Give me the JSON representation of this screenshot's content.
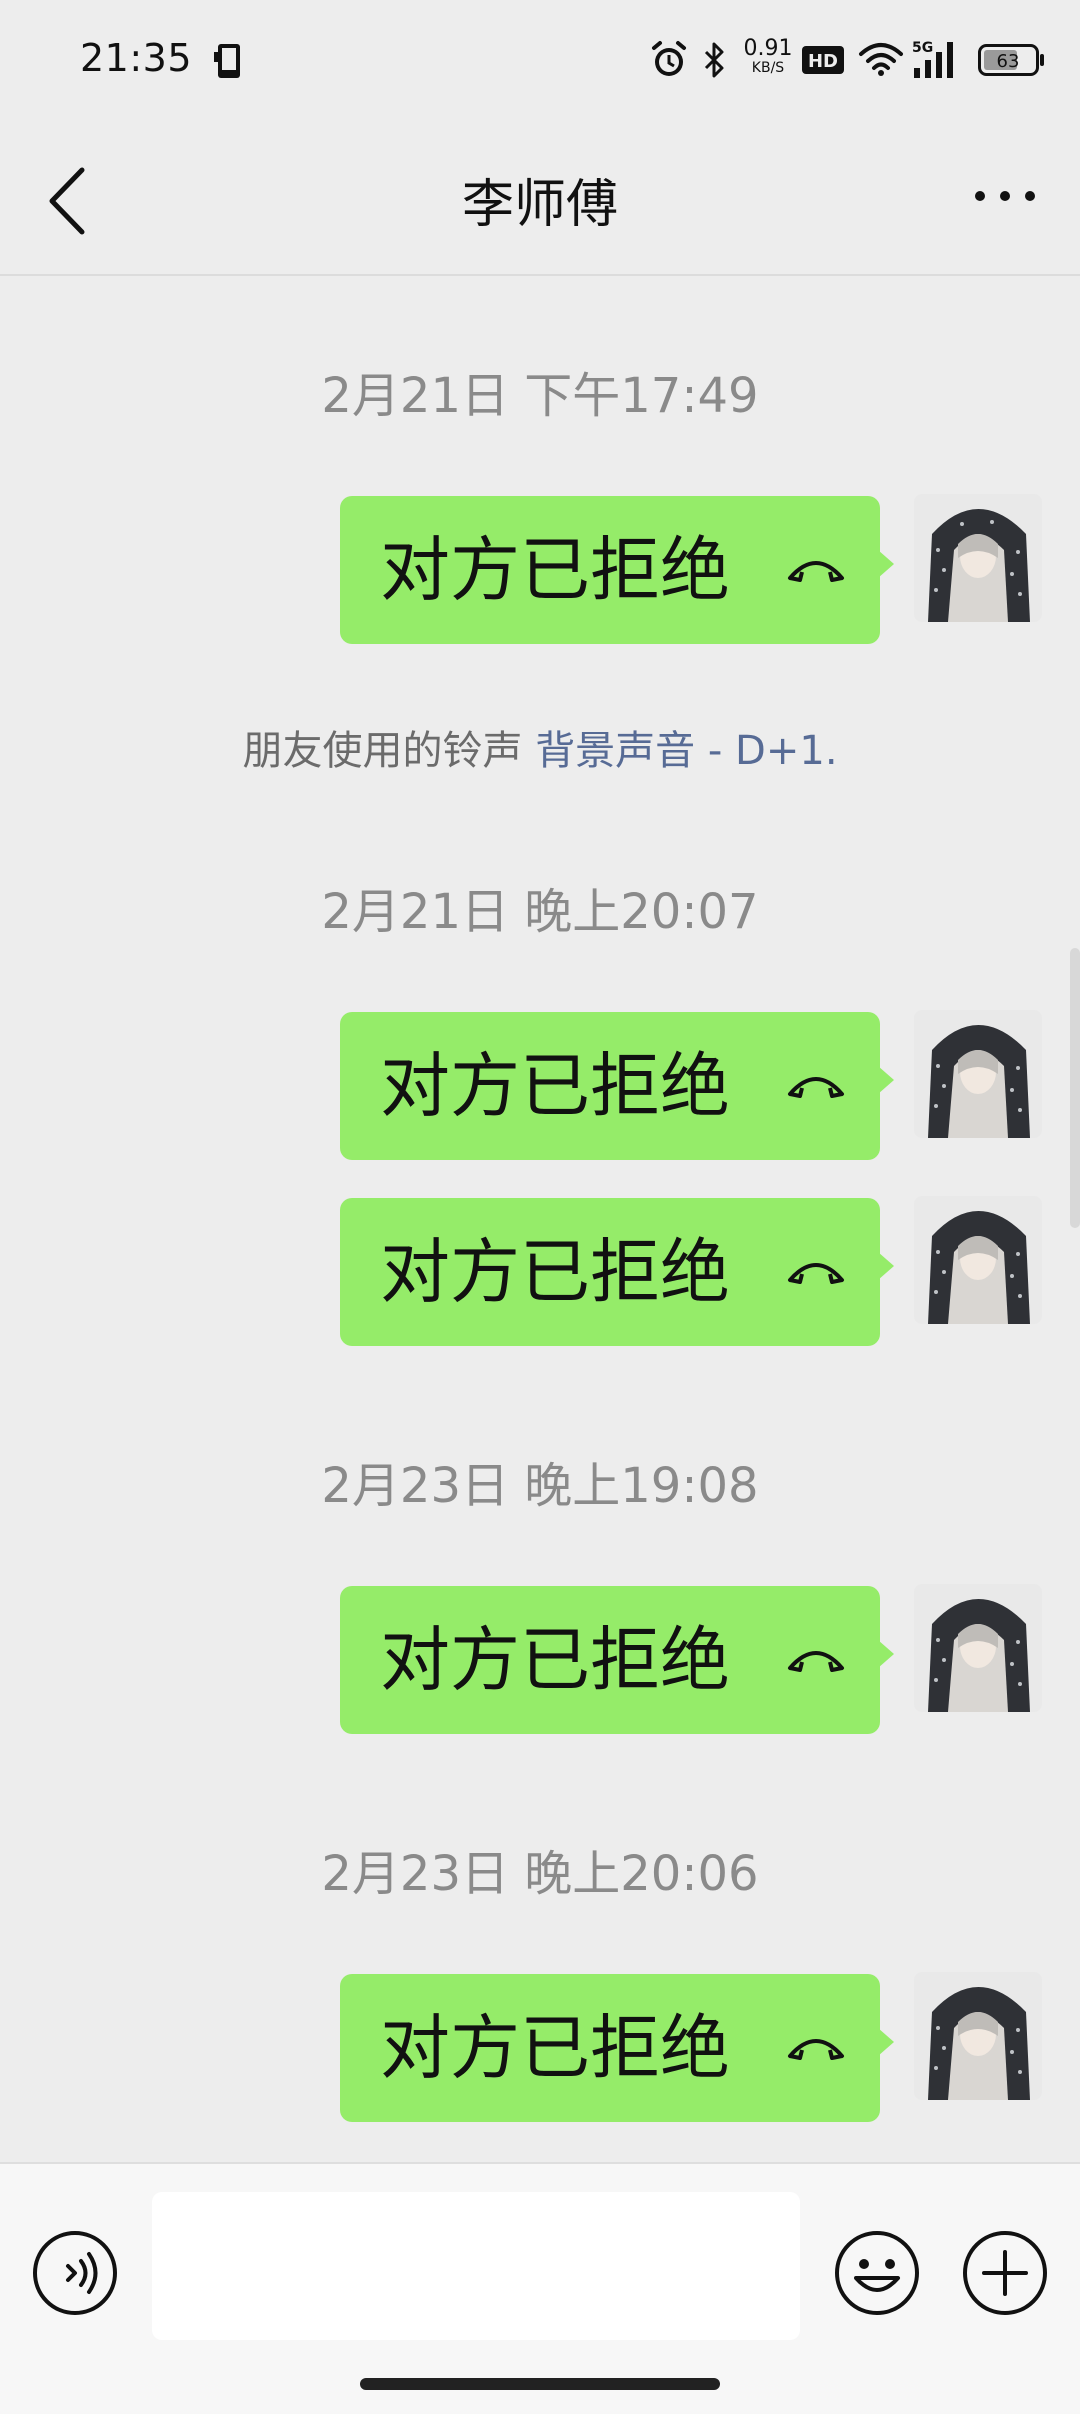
{
  "status_bar": {
    "time": "21:35",
    "net_speed_value": "0.91",
    "net_speed_unit": "KB/S",
    "hd_label": "HD",
    "network_label": "5G",
    "battery_level": "63"
  },
  "header": {
    "title": "李师傅"
  },
  "chat": {
    "timestamps": [
      "2月21日 下午17:49",
      "2月21日 晚上20:07",
      "2月23日 晚上19:08",
      "2月23日 晚上20:06"
    ],
    "system_message": {
      "prefix": "朋友使用的铃声",
      "link": "背景声音 - D+1."
    },
    "messages": [
      {
        "text": "对方已拒绝",
        "icon": "hang-up-icon"
      },
      {
        "text": "对方已拒绝",
        "icon": "hang-up-icon"
      },
      {
        "text": "对方已拒绝",
        "icon": "hang-up-icon"
      },
      {
        "text": "对方已拒绝",
        "icon": "hang-up-icon"
      },
      {
        "text": "对方已拒绝",
        "icon": "hang-up-icon"
      }
    ]
  },
  "input_bar": {
    "placeholder": ""
  },
  "colors": {
    "bubble": "#95ec69",
    "background": "#ededed",
    "link": "#576b95"
  }
}
